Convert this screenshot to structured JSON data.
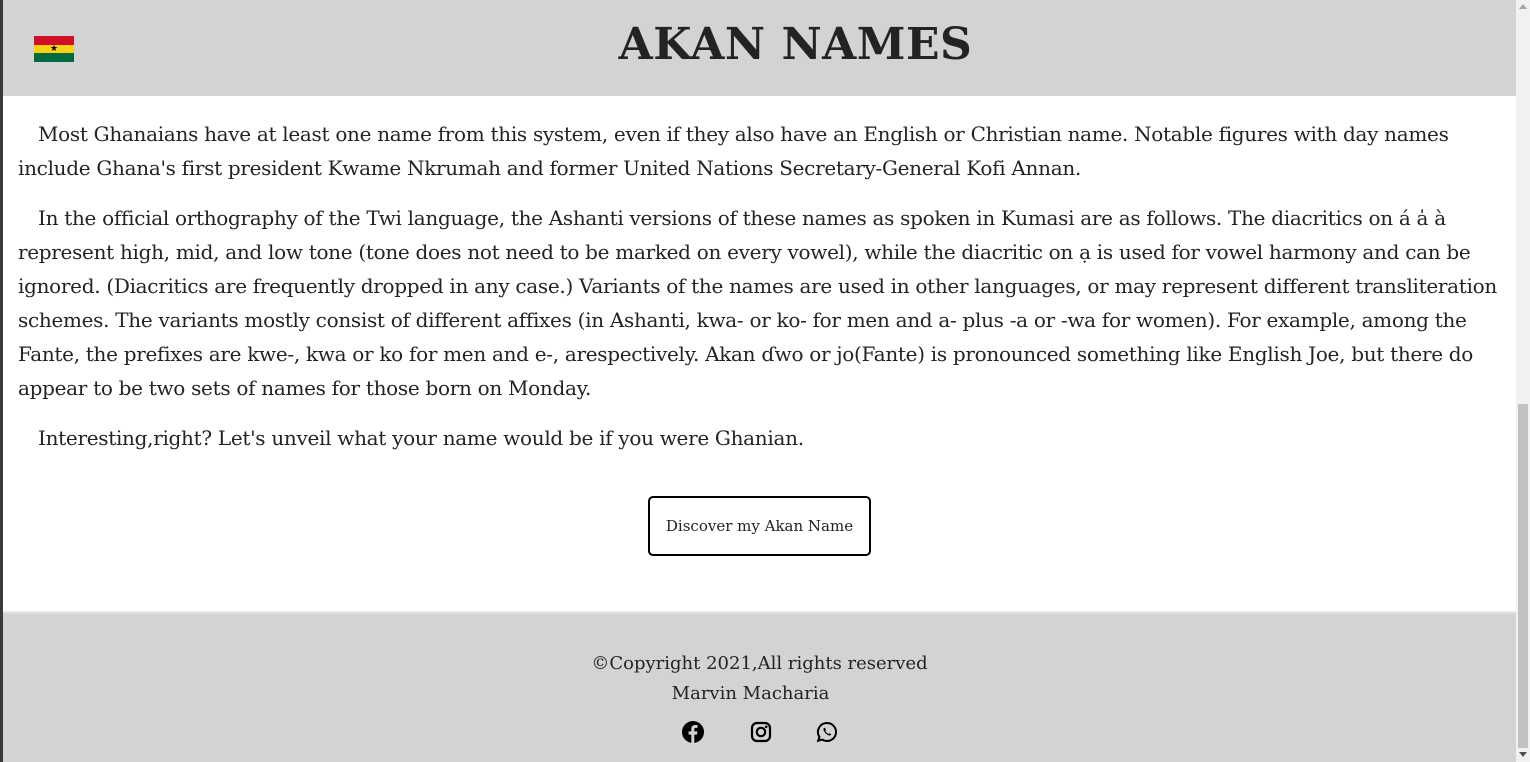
{
  "header": {
    "title": "AKAN NAMES",
    "flag_icon": "ghana-flag-icon",
    "flag_colors": {
      "red": "#ce1126",
      "gold": "#fcd116",
      "green": "#006b3f",
      "star": "#000000"
    },
    "flag_star": "★"
  },
  "main": {
    "paragraphs": [
      "Most Ghanaians have at least one name from this system, even if they also have an English or Christian name. Notable figures with day names include Ghana's first president Kwame Nkrumah and former United Nations Secretary-General Kofi Annan.",
      "In the official orthography of the Twi language, the Ashanti versions of these names as spoken in Kumasi are as follows. The diacritics on á a̍ à represent high, mid, and low tone (tone does not need to be marked on every vowel), while the diacritic on ạ is used for vowel harmony and can be ignored. (Diacritics are frequently dropped in any case.) Variants of the names are used in other languages, or may represent different transliteration schemes. The variants mostly consist of different affixes (in Ashanti, kwa- or ko- for men and a- plus -a or -wa for women). For example, among the Fante, the prefixes are kwe-, kwa or ko for men and e-, arespectively. Akan ɗwo or jo(Fante) is pronounced something like English Joe, but there do appear to be two sets of names for those born on Monday.",
      "Interesting,right? Let's unveil what your name would be if you were Ghanian."
    ],
    "cta_label": "Discover my Akan Name"
  },
  "footer": {
    "copyright": "©Copyright 2021,All rights reserved",
    "author": "Marvin Macharia",
    "social_icons": [
      "facebook-icon",
      "instagram-icon",
      "whatsapp-icon"
    ]
  },
  "colors": {
    "header_bg": "#d3d3d3",
    "footer_bg": "#d3d3d3",
    "text": "#232323",
    "button_border": "#000000"
  }
}
